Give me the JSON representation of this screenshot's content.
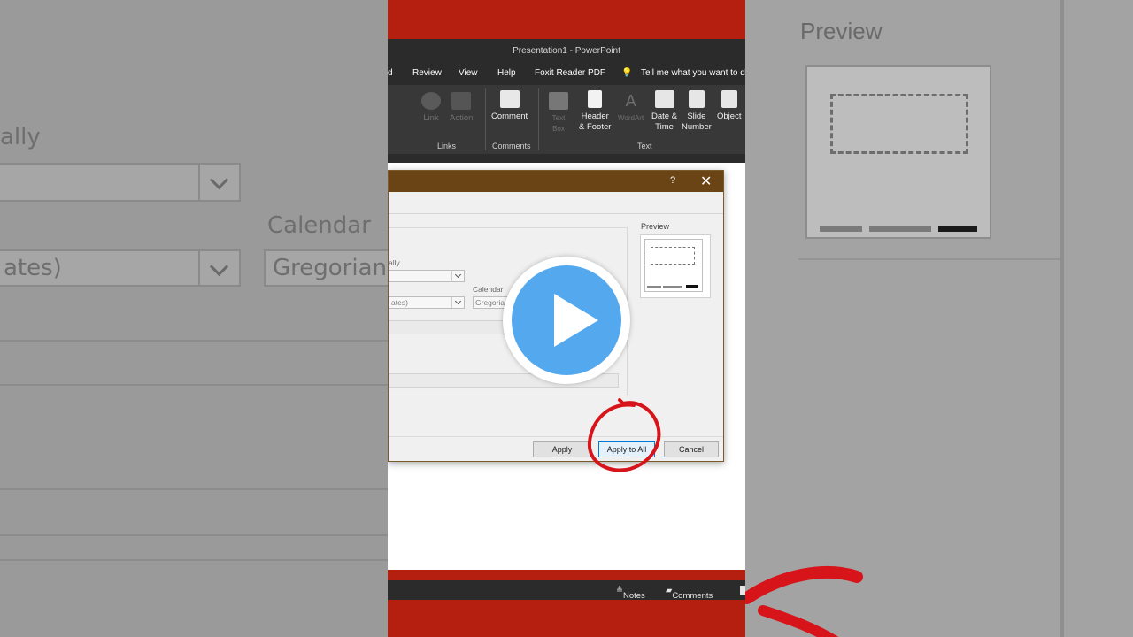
{
  "window": {
    "title": "Presentation1  -  PowerPoint"
  },
  "tabs": [
    "d",
    "Review",
    "View",
    "Help",
    "Foxit Reader PDF",
    "Tell me what you want to d"
  ],
  "ribbon": {
    "link_label": "Link",
    "action_label": "Action",
    "comment_label": "Comment",
    "text_box_label": "Text Box",
    "header_footer_line1": "Header",
    "header_footer_line2": "& Footer",
    "wordart_label": "WordArt",
    "date_time_line1": "Date &",
    "date_time_line2": "Time",
    "slide_number_line1": "Slide",
    "slide_number_line2": "Number",
    "object_label": "Object",
    "groups": {
      "links": "Links",
      "comments": "Comments",
      "text": "Text"
    }
  },
  "background": {
    "left_label_1": "ally",
    "left_label_2": "Calendar",
    "left_value_1": "ates)",
    "left_value_2": "Gregorian",
    "right_preview": "Preview"
  },
  "dialog": {
    "help": "?",
    "close": "✕",
    "language_label": "ally",
    "calendar_label": "Calendar",
    "language_value": "ates)",
    "calendar_value": "Gregoria",
    "preview_label": "Preview",
    "buttons": {
      "apply": "Apply",
      "apply_all": "Apply to All",
      "cancel": "Cancel"
    }
  },
  "status": {
    "notes": "Notes",
    "comments": "Comments"
  },
  "colors": {
    "accent_red": "#b51f10",
    "dialog_title": "#6b4416",
    "play_blue": "#54a8ee",
    "annotation_red": "#d6141a"
  }
}
